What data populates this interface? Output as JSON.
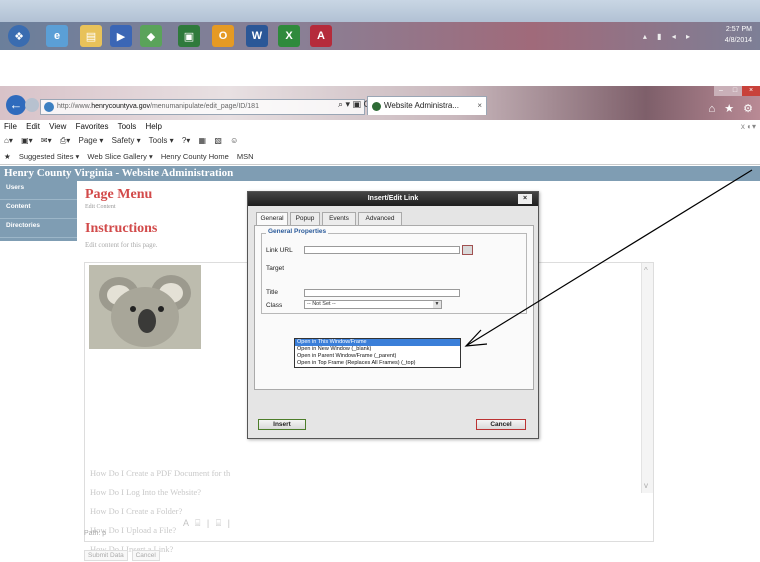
{
  "taskbar": {
    "clock_time": "2:57 PM",
    "clock_date": "4/8/2014",
    "apps": [
      "ie-icon",
      "explorer-icon",
      "media-icon",
      "chrome-icon",
      "outlook-icon",
      "word-icon",
      "excel-icon",
      "access-icon"
    ]
  },
  "browser": {
    "address_prefix": "http://www.",
    "address_domain": "henrycountyva.gov",
    "address_path": "/menumanipulate/edit_page/ID/181",
    "address_tools": "⌕ ▾ ▣ C",
    "tab_title": "Website Administra...",
    "menu": [
      "File",
      "Edit",
      "View",
      "Favorites",
      "Tools",
      "Help"
    ],
    "commands": [
      "Page ▾",
      "Safety ▾",
      "Tools ▾"
    ],
    "favorites": [
      "Suggested Sites ▾",
      "Web Slice Gallery ▾",
      "Henry County Home",
      "MSN"
    ]
  },
  "site": {
    "header": "Henry County Virginia - Website Administration",
    "nav": [
      "Users",
      "Content",
      "Directories"
    ],
    "page_title": "Page Menu",
    "page_subtitle": "Edit Content",
    "instructions_title": "Instructions",
    "instructions_text": "Edit content for this page.",
    "links": [
      "How Do I Create a PDF Document for th",
      "How Do I Log Into the Website?",
      "How Do I Create a Folder?",
      "How Do I Upload a File?",
      "How Do I Insert a Link?"
    ],
    "path": "Path: p",
    "submit_label": "Submit Data",
    "cancel_label": "Cancel"
  },
  "dialog": {
    "title": "Insert/Edit Link",
    "tabs": [
      "General",
      "Popup",
      "Events",
      "Advanced"
    ],
    "active_tab": "General",
    "legend": "General Properties",
    "labels": {
      "link_url": "Link URL",
      "target": "Target",
      "title": "Title",
      "class": "Class"
    },
    "link_url_value": "",
    "title_value": "",
    "class_value": "-- Not Set --",
    "target_options": [
      "Open in This Window/Frame",
      "Open in New Window (_blank)",
      "Open in Parent Window/Frame (_parent)",
      "Open in Top Frame (Replaces All Frames) (_top)"
    ],
    "target_selected_index": 0,
    "insert_label": "Insert",
    "cancel_label": "Cancel"
  },
  "colors": {
    "header_bg": "#7f9db3",
    "title_red": "#d24a4a",
    "selection_blue": "#3b7fd9",
    "arrow": "#000000"
  }
}
